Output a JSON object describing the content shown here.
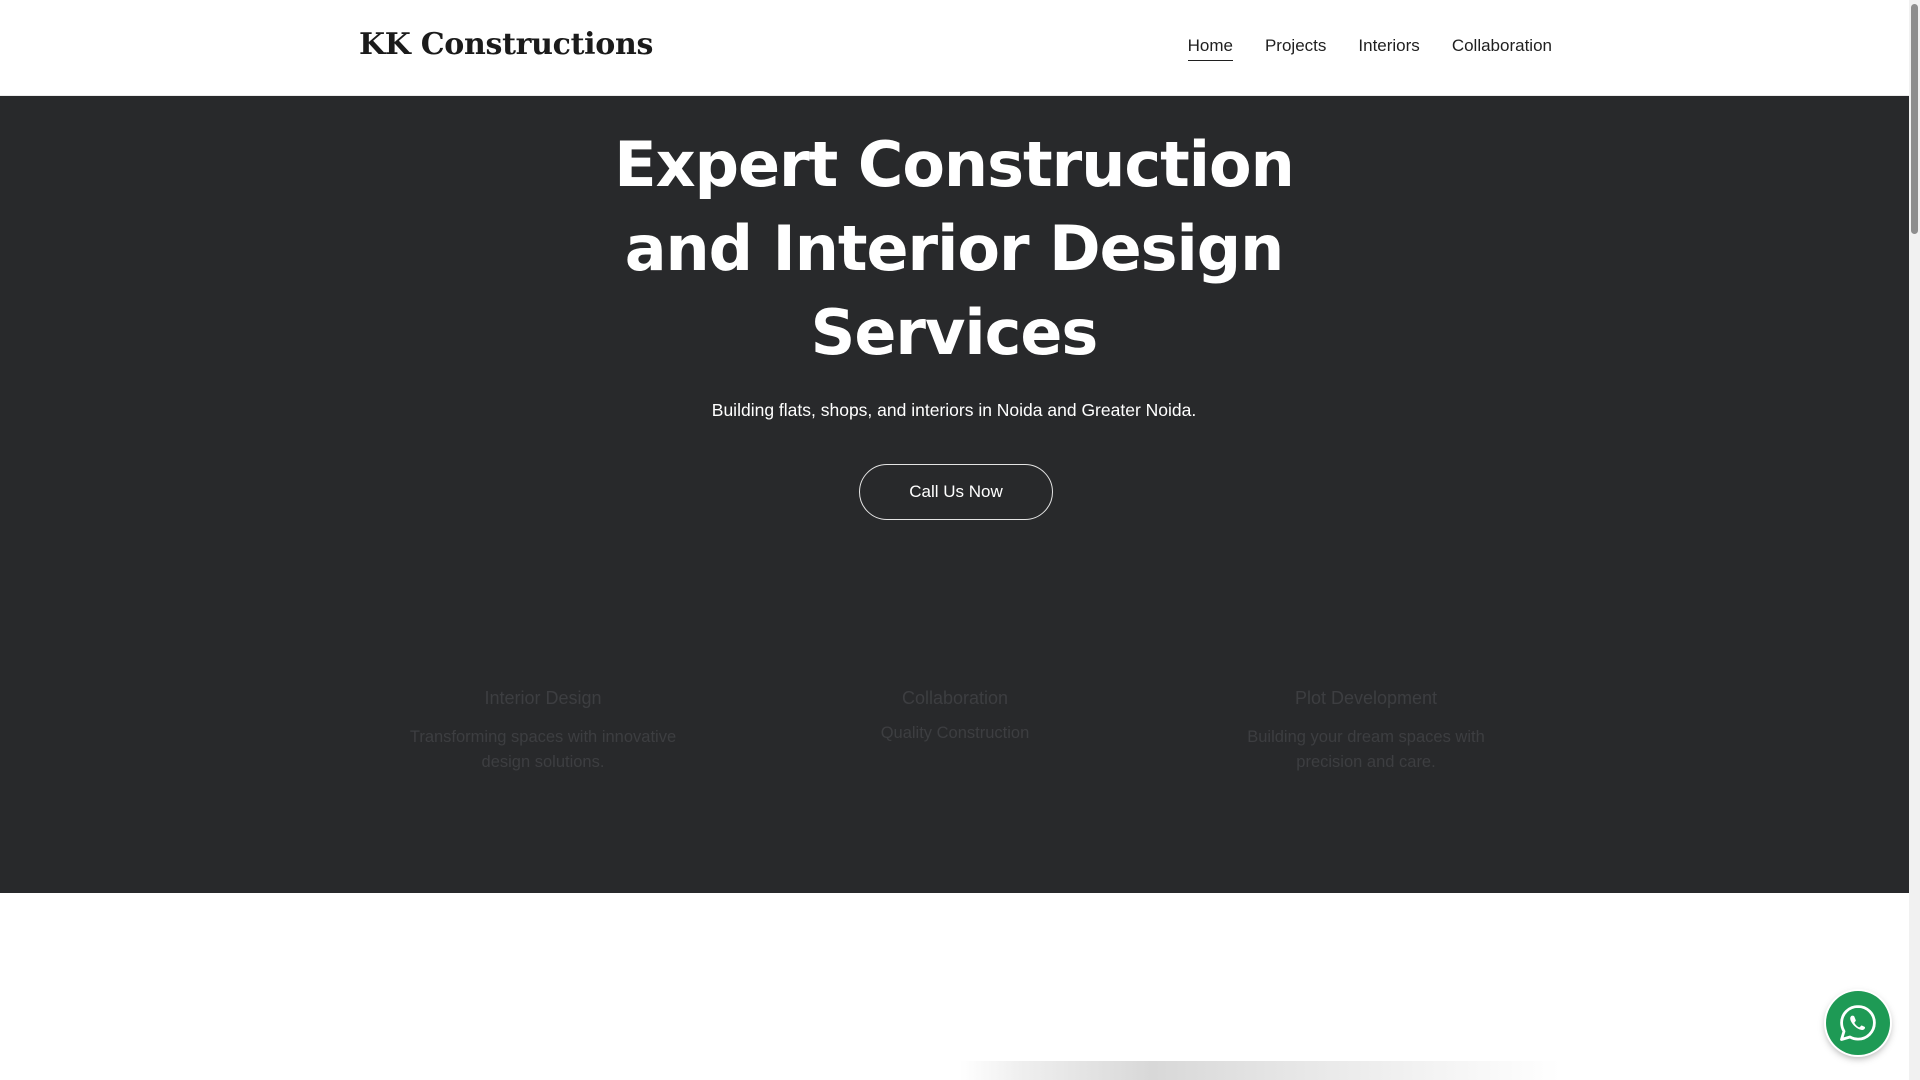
{
  "header": {
    "brand": "KK Constructions",
    "nav": [
      {
        "label": "Home",
        "active": true
      },
      {
        "label": "Projects",
        "active": false
      },
      {
        "label": "Interiors",
        "active": false
      },
      {
        "label": "Collaboration",
        "active": false
      }
    ]
  },
  "hero": {
    "title_lines": [
      "Expert Construction",
      "and Interior Design",
      "Services"
    ],
    "subtitle": "Building flats, shops, and interiors in Noida and Greater Noida.",
    "cta_label": "Call Us Now",
    "background_color": "#28292b"
  },
  "features": [
    {
      "title": "Interior Design",
      "description": "Transforming spaces with innovative design solutions."
    },
    {
      "title": "Collaboration",
      "description": "Quality Construction"
    },
    {
      "title": "Plot Development",
      "description": "Building your dream spaces with precision and care."
    }
  ],
  "floating": {
    "icon": "whatsapp-icon",
    "color": "#1e9a55"
  }
}
